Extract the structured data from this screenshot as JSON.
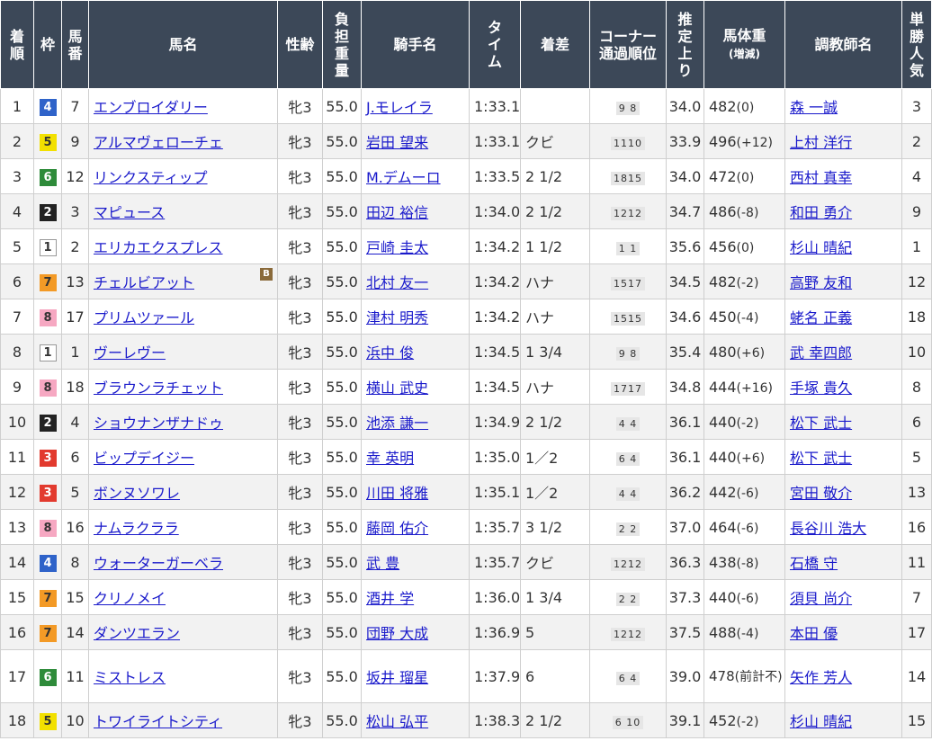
{
  "headers": {
    "rank": "着\n順",
    "waku": "枠",
    "umaban": "馬\n番",
    "name": "馬名",
    "sexage": "性齢",
    "weight": "負\n担\n重\n量",
    "jockey": "騎手名",
    "time": "タ\nイ\nム",
    "margin": "着差",
    "corner": "コーナー\n通過順位",
    "last3f": "推\n定\n上\nり",
    "horse_weight": "馬体重",
    "horse_weight_sub": "(増減)",
    "trainer": "調教師名",
    "popularity": "単\n勝\n人\n気"
  },
  "blinker_label": "B",
  "rows": [
    {
      "rank": "1",
      "waku": "4",
      "umaban": "7",
      "name": "エンブロイダリー",
      "sexage": "牝3",
      "weight": "55.0",
      "jockey": "J.モレイラ",
      "time": "1:33.1",
      "margin": "",
      "corner": "9 8",
      "last3f": "34.0",
      "hw": "482",
      "hwd": "(0)",
      "trainer": "森 一誠",
      "pop": "3"
    },
    {
      "rank": "2",
      "waku": "5",
      "umaban": "9",
      "name": "アルマヴェローチェ",
      "sexage": "牝3",
      "weight": "55.0",
      "jockey": "岩田 望来",
      "time": "1:33.1",
      "margin": "クビ",
      "corner": "1110",
      "last3f": "33.9",
      "hw": "496",
      "hwd": "(+12)",
      "trainer": "上村 洋行",
      "pop": "2"
    },
    {
      "rank": "3",
      "waku": "6",
      "umaban": "12",
      "name": "リンクスティップ",
      "sexage": "牝3",
      "weight": "55.0",
      "jockey": "M.デムーロ",
      "time": "1:33.5",
      "margin": "2 1/2",
      "corner": "1815",
      "last3f": "34.0",
      "hw": "472",
      "hwd": "(0)",
      "trainer": "西村 真幸",
      "pop": "4"
    },
    {
      "rank": "4",
      "waku": "2",
      "umaban": "3",
      "name": "マピュース",
      "sexage": "牝3",
      "weight": "55.0",
      "jockey": "田辺 裕信",
      "time": "1:34.0",
      "margin": "2 1/2",
      "corner": "1212",
      "last3f": "34.7",
      "hw": "486",
      "hwd": "(-8)",
      "trainer": "和田 勇介",
      "pop": "9"
    },
    {
      "rank": "5",
      "waku": "1",
      "umaban": "2",
      "name": "エリカエクスプレス",
      "sexage": "牝3",
      "weight": "55.0",
      "jockey": "戸崎 圭太",
      "time": "1:34.2",
      "margin": "1 1/2",
      "corner": "1 1",
      "last3f": "35.6",
      "hw": "456",
      "hwd": "(0)",
      "trainer": "杉山 晴紀",
      "pop": "1"
    },
    {
      "rank": "6",
      "waku": "7",
      "umaban": "13",
      "name": "チェルビアット",
      "sexage": "牝3",
      "weight": "55.0",
      "jockey": "北村 友一",
      "time": "1:34.2",
      "margin": "ハナ",
      "corner": "1517",
      "last3f": "34.5",
      "hw": "482",
      "hwd": "(-2)",
      "trainer": "高野 友和",
      "pop": "12",
      "blinker": true
    },
    {
      "rank": "7",
      "waku": "8",
      "umaban": "17",
      "name": "プリムツァール",
      "sexage": "牝3",
      "weight": "55.0",
      "jockey": "津村 明秀",
      "time": "1:34.2",
      "margin": "ハナ",
      "corner": "1515",
      "last3f": "34.6",
      "hw": "450",
      "hwd": "(-4)",
      "trainer": "蛯名 正義",
      "pop": "18"
    },
    {
      "rank": "8",
      "waku": "1",
      "umaban": "1",
      "name": "ヴーレヴー",
      "sexage": "牝3",
      "weight": "55.0",
      "jockey": "浜中 俊",
      "time": "1:34.5",
      "margin": "1 3/4",
      "corner": "9 8",
      "last3f": "35.4",
      "hw": "480",
      "hwd": "(+6)",
      "trainer": "武 幸四郎",
      "pop": "10"
    },
    {
      "rank": "9",
      "waku": "8",
      "umaban": "18",
      "name": "ブラウンラチェット",
      "sexage": "牝3",
      "weight": "55.0",
      "jockey": "横山 武史",
      "time": "1:34.5",
      "margin": "ハナ",
      "corner": "1717",
      "last3f": "34.8",
      "hw": "444",
      "hwd": "(+16)",
      "trainer": "手塚 貴久",
      "pop": "8"
    },
    {
      "rank": "10",
      "waku": "2",
      "umaban": "4",
      "name": "ショウナンザナドゥ",
      "sexage": "牝3",
      "weight": "55.0",
      "jockey": "池添 謙一",
      "time": "1:34.9",
      "margin": "2 1/2",
      "corner": "4 4",
      "last3f": "36.1",
      "hw": "440",
      "hwd": "(-2)",
      "trainer": "松下 武士",
      "pop": "6"
    },
    {
      "rank": "11",
      "waku": "3",
      "umaban": "6",
      "name": "ビップデイジー",
      "sexage": "牝3",
      "weight": "55.0",
      "jockey": "幸 英明",
      "time": "1:35.0",
      "margin": "1／2",
      "corner": "6 4",
      "last3f": "36.1",
      "hw": "440",
      "hwd": "(+6)",
      "trainer": "松下 武士",
      "pop": "5"
    },
    {
      "rank": "12",
      "waku": "3",
      "umaban": "5",
      "name": "ボンヌソワレ",
      "sexage": "牝3",
      "weight": "55.0",
      "jockey": "川田 将雅",
      "time": "1:35.1",
      "margin": "1／2",
      "corner": "4 4",
      "last3f": "36.2",
      "hw": "442",
      "hwd": "(-6)",
      "trainer": "宮田 敬介",
      "pop": "13"
    },
    {
      "rank": "13",
      "waku": "8",
      "umaban": "16",
      "name": "ナムラクララ",
      "sexage": "牝3",
      "weight": "55.0",
      "jockey": "藤岡 佑介",
      "time": "1:35.7",
      "margin": "3 1/2",
      "corner": "2 2",
      "last3f": "37.0",
      "hw": "464",
      "hwd": "(-6)",
      "trainer": "長谷川 浩大",
      "pop": "16"
    },
    {
      "rank": "14",
      "waku": "4",
      "umaban": "8",
      "name": "ウォーターガーベラ",
      "sexage": "牝3",
      "weight": "55.0",
      "jockey": "武 豊",
      "time": "1:35.7",
      "margin": "クビ",
      "corner": "1212",
      "last3f": "36.3",
      "hw": "438",
      "hwd": "(-8)",
      "trainer": "石橋 守",
      "pop": "11"
    },
    {
      "rank": "15",
      "waku": "7",
      "umaban": "15",
      "name": "クリノメイ",
      "sexage": "牝3",
      "weight": "55.0",
      "jockey": "酒井 学",
      "time": "1:36.0",
      "margin": "1 3/4",
      "corner": "2 2",
      "last3f": "37.3",
      "hw": "440",
      "hwd": "(-6)",
      "trainer": "須貝 尚介",
      "pop": "7"
    },
    {
      "rank": "16",
      "waku": "7",
      "umaban": "14",
      "name": "ダンツエラン",
      "sexage": "牝3",
      "weight": "55.0",
      "jockey": "団野 大成",
      "time": "1:36.9",
      "margin": "5",
      "corner": "1212",
      "last3f": "37.5",
      "hw": "488",
      "hwd": "(-4)",
      "trainer": "本田 優",
      "pop": "17"
    },
    {
      "rank": "17",
      "waku": "6",
      "umaban": "11",
      "name": "ミストレス",
      "sexage": "牝3",
      "weight": "55.0",
      "jockey": "坂井 瑠星",
      "time": "1:37.9",
      "margin": "6",
      "corner": "6 4",
      "last3f": "39.0",
      "hw": "478",
      "hwd": "(前計不)",
      "trainer": "矢作 芳人",
      "pop": "14",
      "tall": true
    },
    {
      "rank": "18",
      "waku": "5",
      "umaban": "10",
      "name": "トワイライトシティ",
      "sexage": "牝3",
      "weight": "55.0",
      "jockey": "松山 弘平",
      "time": "1:38.3",
      "margin": "2 1/2",
      "corner": "6 10",
      "last3f": "39.1",
      "hw": "452",
      "hwd": "(-2)",
      "trainer": "杉山 晴紀",
      "pop": "15"
    }
  ]
}
